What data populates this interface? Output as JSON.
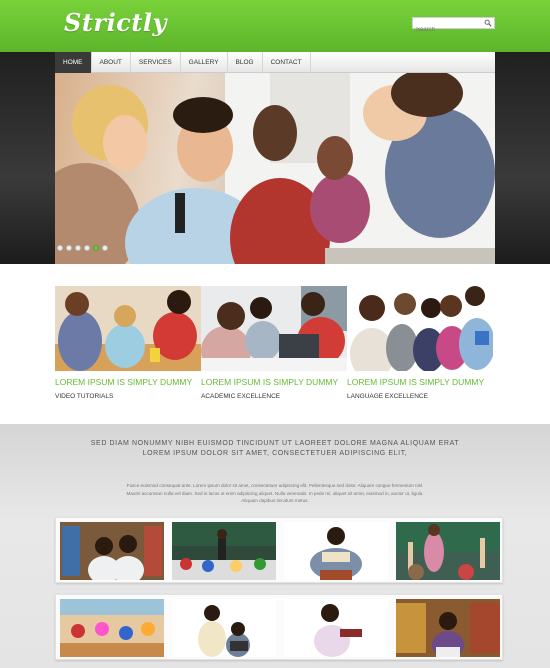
{
  "header": {
    "logo": "Strictly",
    "search_placeholder": "Search"
  },
  "nav": [
    "HOME",
    "ABOUT",
    "SERVICES",
    "GALLERY",
    "BLOG",
    "CONTACT"
  ],
  "slider": {
    "slides": 6,
    "active_index": 4,
    "accent": "#66bb33"
  },
  "features": [
    {
      "title": "LOREM IPSUM IS SIMPLY DUMMY",
      "subtitle": "VIDEO TUTORIALS"
    },
    {
      "title": "LOREM IPSUM IS SIMPLY DUMMY",
      "subtitle": "ACADEMIC EXCELLENCE"
    },
    {
      "title": "LOREM IPSUM IS SIMPLY DUMMY",
      "subtitle": "LANGUAGE EXCELLENCE"
    }
  ],
  "intro": {
    "line1": "SED DIAM NONUMMY NIBH EUISMOD TINCIDUNT UT LAOREET DOLORE MAGNA ALIQUAM ERAT",
    "line2": "LOREM IPSUM DOLOR SIT AMET, CONSECTETUER ADIPISCING ELIT,",
    "small1": "Fusce euismod consequat ante. Lorem ipsum dolor sit amet, consectetuer adipiscing elit. Pellentesque sed dolor. Aliquam congue fermentum nisl.",
    "small2": "Mauris accumsan nulla vel diam. Sed in lacus ut enim adipiscing aliquet. Nulla venenatis. In pede mi, aliquet sit amet, euismod in, auctor ut, ligula.",
    "small3": "Aliquam dapibus tincidunt metus."
  },
  "colors": {
    "brand_green": "#66bb33",
    "header_green": "#79d23a"
  }
}
